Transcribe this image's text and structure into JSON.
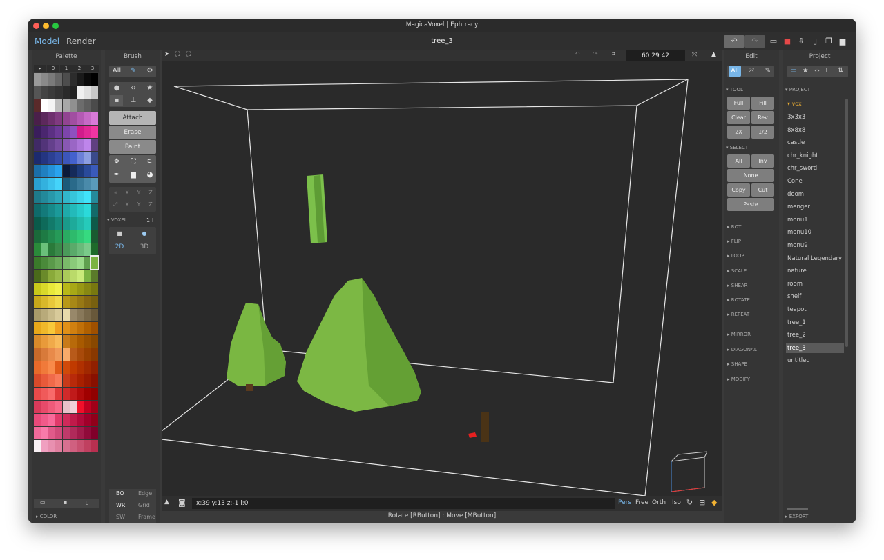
{
  "window": {
    "title": "MagicaVoxel | Ephtracy",
    "filename": "tree_3"
  },
  "tabs": {
    "model": "Model",
    "render": "Render"
  },
  "colors": {
    "accent": "#78b6e8",
    "tree_green": "#7cb342",
    "selected_orange": "#f2b233",
    "bg": "#2a2a2a"
  },
  "palette": {
    "header": "Palette",
    "pages": [
      "▸",
      "0",
      "1",
      "2",
      "3"
    ],
    "footer": "COLOR"
  },
  "brush": {
    "header": "Brush",
    "all_label": "All",
    "modes": [
      "Attach",
      "Erase",
      "Paint"
    ],
    "axis_rows": [
      [
        "X",
        "Y",
        "Z"
      ],
      [
        "X",
        "Y",
        "Z"
      ]
    ],
    "voxel_label": "VOXEL",
    "voxel_value": "1",
    "dim_2d": "2D",
    "dim_3d": "3D",
    "bottom": [
      [
        "BO",
        "Edge"
      ],
      [
        "WR",
        "Grid"
      ],
      [
        "SW",
        "Frame"
      ]
    ]
  },
  "viewport": {
    "coords": "60  29  42",
    "status": "x:39   y:13   z:-1   i:0",
    "views": [
      "Pers",
      "Free",
      "Orth",
      "Iso"
    ],
    "hint": "Rotate [RButton] : Move [MButton]"
  },
  "edit": {
    "header": "Edit",
    "all_label": "All",
    "tool_label": "TOOL",
    "tool_buttons": [
      [
        "Full",
        "Fill"
      ],
      [
        "Clear",
        "Rev"
      ],
      [
        "2X",
        "1/2"
      ]
    ],
    "select_label": "SELECT",
    "select_buttons": [
      [
        "All",
        "Inv"
      ],
      [
        "None"
      ],
      [
        "Copy",
        "Cut"
      ],
      [
        "Paste"
      ]
    ],
    "sections": [
      "ROT",
      "FLIP",
      "LOOP",
      "SCALE",
      "SHEAR",
      "ROTATE",
      "REPEAT"
    ],
    "sections2": [
      "MIRROR",
      "DIAGONAL",
      "SHAPE",
      "MODIFY"
    ]
  },
  "project": {
    "header": "Project",
    "label": "PROJECT",
    "folder": "vox",
    "items": [
      "3x3x3",
      "8x8x8",
      "castle",
      "chr_knight",
      "chr_sword",
      "Cone",
      "doom",
      "menger",
      "monu1",
      "monu10",
      "monu9",
      "Natural Legendary L",
      "nature",
      "room",
      "shelf",
      "teapot",
      "tree_1",
      "tree_2",
      "tree_3",
      "untitled"
    ],
    "selected": "tree_3",
    "footer": "EXPORT"
  }
}
